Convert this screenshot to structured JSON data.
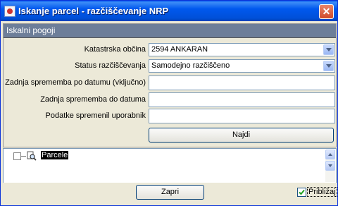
{
  "window": {
    "title": "Iskanje parcel - razčiščevanje NRP",
    "close_glyph": "✕"
  },
  "panel": {
    "header": "Iskalni pogoji"
  },
  "form": {
    "katastrska_label": "Katastrska občina",
    "katastrska_value": "2594  ANKARAN",
    "status_label": "Status razčiščevanja",
    "status_value": "Samodejno razčiščeno",
    "from_date_label": "Zadnja sprememba po datumu (vključno)",
    "from_date_value": "",
    "to_date_label": "Zadnja sprememba do datuma",
    "to_date_value": "",
    "user_label": "Podatke spremenil uporabnik",
    "user_value": "",
    "search_button": "Najdi"
  },
  "tree": {
    "root_label": "Parcele"
  },
  "footer": {
    "close_button": "Zapri",
    "zoom_checkbox_label": "Približaj",
    "zoom_checked": true
  },
  "icons": {
    "combo_arrow": "chevron-down-icon",
    "tree_node": "magnifier-document-icon"
  },
  "colors": {
    "titlebar": "#0058ee",
    "panel_header": "#6d7e99",
    "close": "#d04a2a"
  }
}
